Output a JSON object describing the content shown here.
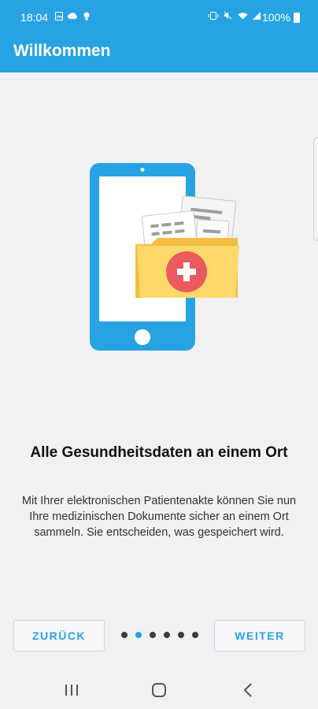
{
  "status_bar": {
    "time": "18:04",
    "battery": "100%",
    "left_icons": [
      "photo-icon",
      "cloud-icon",
      "bulb-icon"
    ],
    "right_icons": [
      "vibrate-icon",
      "mute-icon",
      "wifi-icon",
      "signal-icon",
      "battery-icon"
    ]
  },
  "app_bar": {
    "title": "Willkommen"
  },
  "onboarding": {
    "illustration_icon": "medical-folder-phone-icon",
    "headline": "Alle Gesundheitsdaten an einem Ort",
    "body": "Mit Ihrer elektronischen Patientenakte können Sie nun Ihre medizinischen Dokumente sicher an einem Ort sammeln. Sie entscheiden, was gespeichert wird.",
    "back_label": "ZURÜCK",
    "next_label": "WEITER",
    "page_count": 6,
    "current_page": 2
  },
  "nav_bar": {
    "buttons": [
      "recent-apps-icon",
      "home-icon",
      "back-icon"
    ]
  },
  "colors": {
    "accent": "#27a3e3",
    "folder": "#fdd86a",
    "cross_badge": "#ea5a5f"
  }
}
